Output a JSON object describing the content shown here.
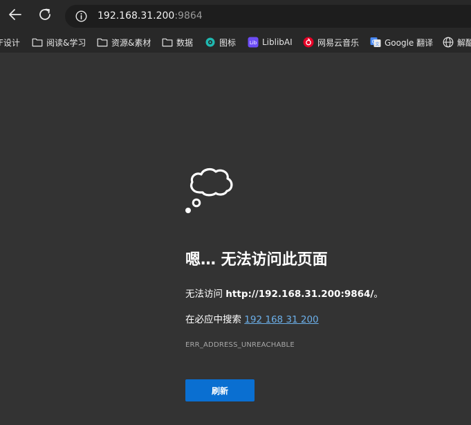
{
  "address_bar": {
    "host": "192.168.31.200",
    "port": ":9864"
  },
  "bookmarks": [
    {
      "label": "F设计",
      "icon": "none"
    },
    {
      "label": "阅读&学习",
      "icon": "folder-icon"
    },
    {
      "label": "资源&素材",
      "icon": "folder-icon"
    },
    {
      "label": "数据",
      "icon": "folder-icon"
    },
    {
      "label": "图标",
      "icon": "iconfont-icon"
    },
    {
      "label": "LiblibAI",
      "icon": "liblib-icon"
    },
    {
      "label": "网易云音乐",
      "icon": "netease-music-icon"
    },
    {
      "label": "Google 翻译",
      "icon": "google-translate-icon"
    },
    {
      "label": "解酷",
      "icon": "globe-icon"
    }
  ],
  "error": {
    "title": "嗯… 无法访问此页面",
    "line1_prefix": "无法访问 ",
    "line1_url": "http://192.168.31.200:9864/",
    "line1_suffix": "。",
    "line2_prefix": "在必应中搜索 ",
    "search_link": "192 168 31 200",
    "code": "ERR_ADDRESS_UNREACHABLE",
    "refresh_label": "刷新"
  },
  "colors": {
    "page_bg": "#333333",
    "toolbar_bg": "#282828",
    "address_bg": "#1d1d1d",
    "link": "#6cb0ea",
    "button": "#0a6fd1"
  }
}
